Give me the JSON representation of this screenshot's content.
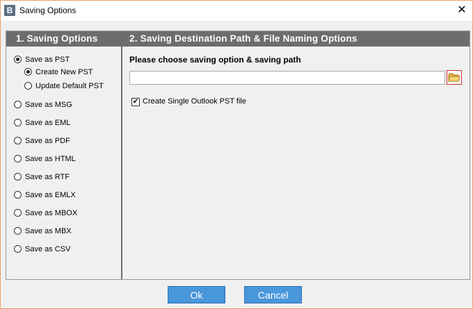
{
  "window": {
    "title": "Saving Options",
    "app_icon_letter": "B",
    "close_glyph": "✕"
  },
  "left_panel": {
    "header": "1. Saving Options",
    "options": [
      {
        "label": "Save as PST",
        "checked": true
      },
      {
        "label": "Create New PST",
        "checked": true,
        "sub": true
      },
      {
        "label": "Update Default PST",
        "checked": false,
        "sub": true
      },
      {
        "label": "Save as MSG",
        "checked": false
      },
      {
        "label": "Save as EML",
        "checked": false
      },
      {
        "label": "Save as PDF",
        "checked": false
      },
      {
        "label": "Save as HTML",
        "checked": false
      },
      {
        "label": "Save as RTF",
        "checked": false
      },
      {
        "label": "Save as EMLX",
        "checked": false
      },
      {
        "label": "Save as MBOX",
        "checked": false
      },
      {
        "label": "Save as MBX",
        "checked": false
      },
      {
        "label": "Save as CSV",
        "checked": false
      }
    ]
  },
  "right_panel": {
    "header": "2. Saving Destination Path & File Naming Options",
    "section_title": "Please choose saving option & saving path",
    "path_value": "",
    "browse_icon": "folder-open-icon",
    "single_pst_label": "Create Single Outlook PST file",
    "single_pst_checked": true,
    "check_glyph": "✔"
  },
  "footer": {
    "ok_label": "Ok",
    "cancel_label": "Cancel"
  }
}
